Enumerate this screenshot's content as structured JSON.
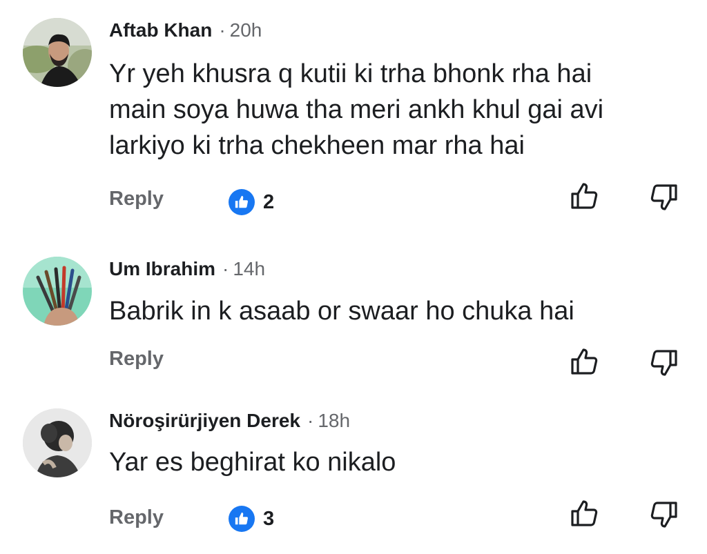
{
  "comments": [
    {
      "author": "Aftab Khan",
      "separator": "·",
      "time": "20h",
      "lines": [
        "Yr yeh khusra q kutii ki trha bhonk rha hai",
        "main soya huwa tha meri ankh khul gai avi",
        "larkiyo ki trha chekheen mar rha hai"
      ],
      "reply_label": "Reply",
      "reaction_count": "2",
      "avatar_icon": "person-avatar"
    },
    {
      "author": "Um Ibrahim",
      "separator": "·",
      "time": "14h",
      "lines": [
        "Babrik in k  asaab or swaar ho  chuka hai"
      ],
      "reply_label": "Reply",
      "reaction_count": "",
      "avatar_icon": "paintbrushes-avatar"
    },
    {
      "author": "Nöroşirürjiyen Derek",
      "separator": "·",
      "time": "18h",
      "lines": [
        "Yar es beghirat ko nikalo"
      ],
      "reply_label": "Reply",
      "reaction_count": "3",
      "avatar_icon": "portrait-avatar"
    }
  ],
  "colors": {
    "like_blue": "#1877f2",
    "meta_gray": "#65676b",
    "text": "#1c1e21"
  },
  "icons": {
    "like": "thumbs-up-outline-icon",
    "dislike": "thumbs-down-outline-icon",
    "reaction": "like-reaction-icon"
  }
}
